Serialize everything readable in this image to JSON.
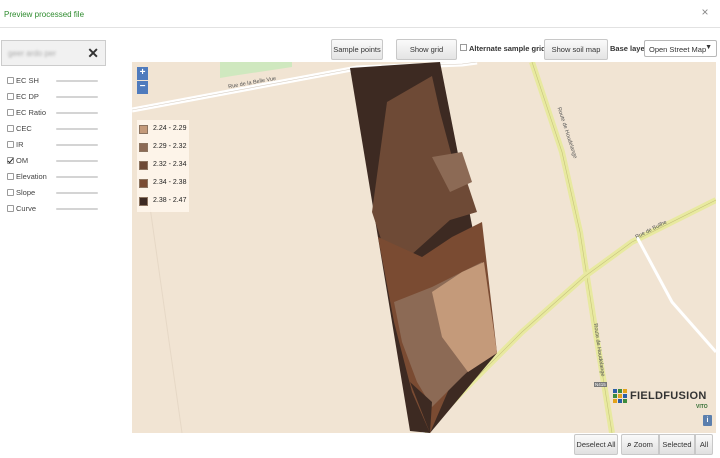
{
  "dialog": {
    "title": "Preview processed file",
    "close_icon": "close-icon"
  },
  "sidebar": {
    "search_value": "geer ardo per",
    "layers": [
      {
        "label": "EC SH",
        "checked": false
      },
      {
        "label": "EC DP",
        "checked": false
      },
      {
        "label": "EC Ratio",
        "checked": false
      },
      {
        "label": "CEC",
        "checked": false
      },
      {
        "label": "IR",
        "checked": false
      },
      {
        "label": "OM",
        "checked": true
      },
      {
        "label": "Elevation",
        "checked": false
      },
      {
        "label": "Slope",
        "checked": false
      },
      {
        "label": "Curve",
        "checked": false
      }
    ]
  },
  "toolbar": {
    "sample_points": "Sample points",
    "show_grid_overlay": "Show grid overlay",
    "alternate_sample_grid": "Alternate sample grid",
    "show_soil_map": "Show soil map",
    "base_layer_label": "Base layer:",
    "base_layer_value": "Open Street Map"
  },
  "map": {
    "zoom_in": "+",
    "zoom_out": "−",
    "legend": [
      {
        "label": "2.24 - 2.29",
        "color": "#c49a7a"
      },
      {
        "label": "2.29 - 2.32",
        "color": "#8c6a55"
      },
      {
        "label": "2.32 - 2.34",
        "color": "#6e4a36"
      },
      {
        "label": "2.34 - 2.38",
        "color": "#7a4b32"
      },
      {
        "label": "2.38 - 2.47",
        "color": "#3d2a22"
      }
    ],
    "roads": {
      "rue_belle_vue": "Rue de la Belle Vue",
      "route_houdelange_1": "Route de Houdelange",
      "route_houdelange_2": "Route de Houdelange",
      "rue_bullhe": "Rue de Bullhe",
      "sign": "N415"
    },
    "brand": {
      "name": "FIELDFUSION",
      "sub": "VITO"
    },
    "info": "i"
  },
  "bottom_bar": {
    "deselect_all": "Deselect All",
    "zoom": "Zoom",
    "selected": "Selected",
    "all": "All"
  }
}
